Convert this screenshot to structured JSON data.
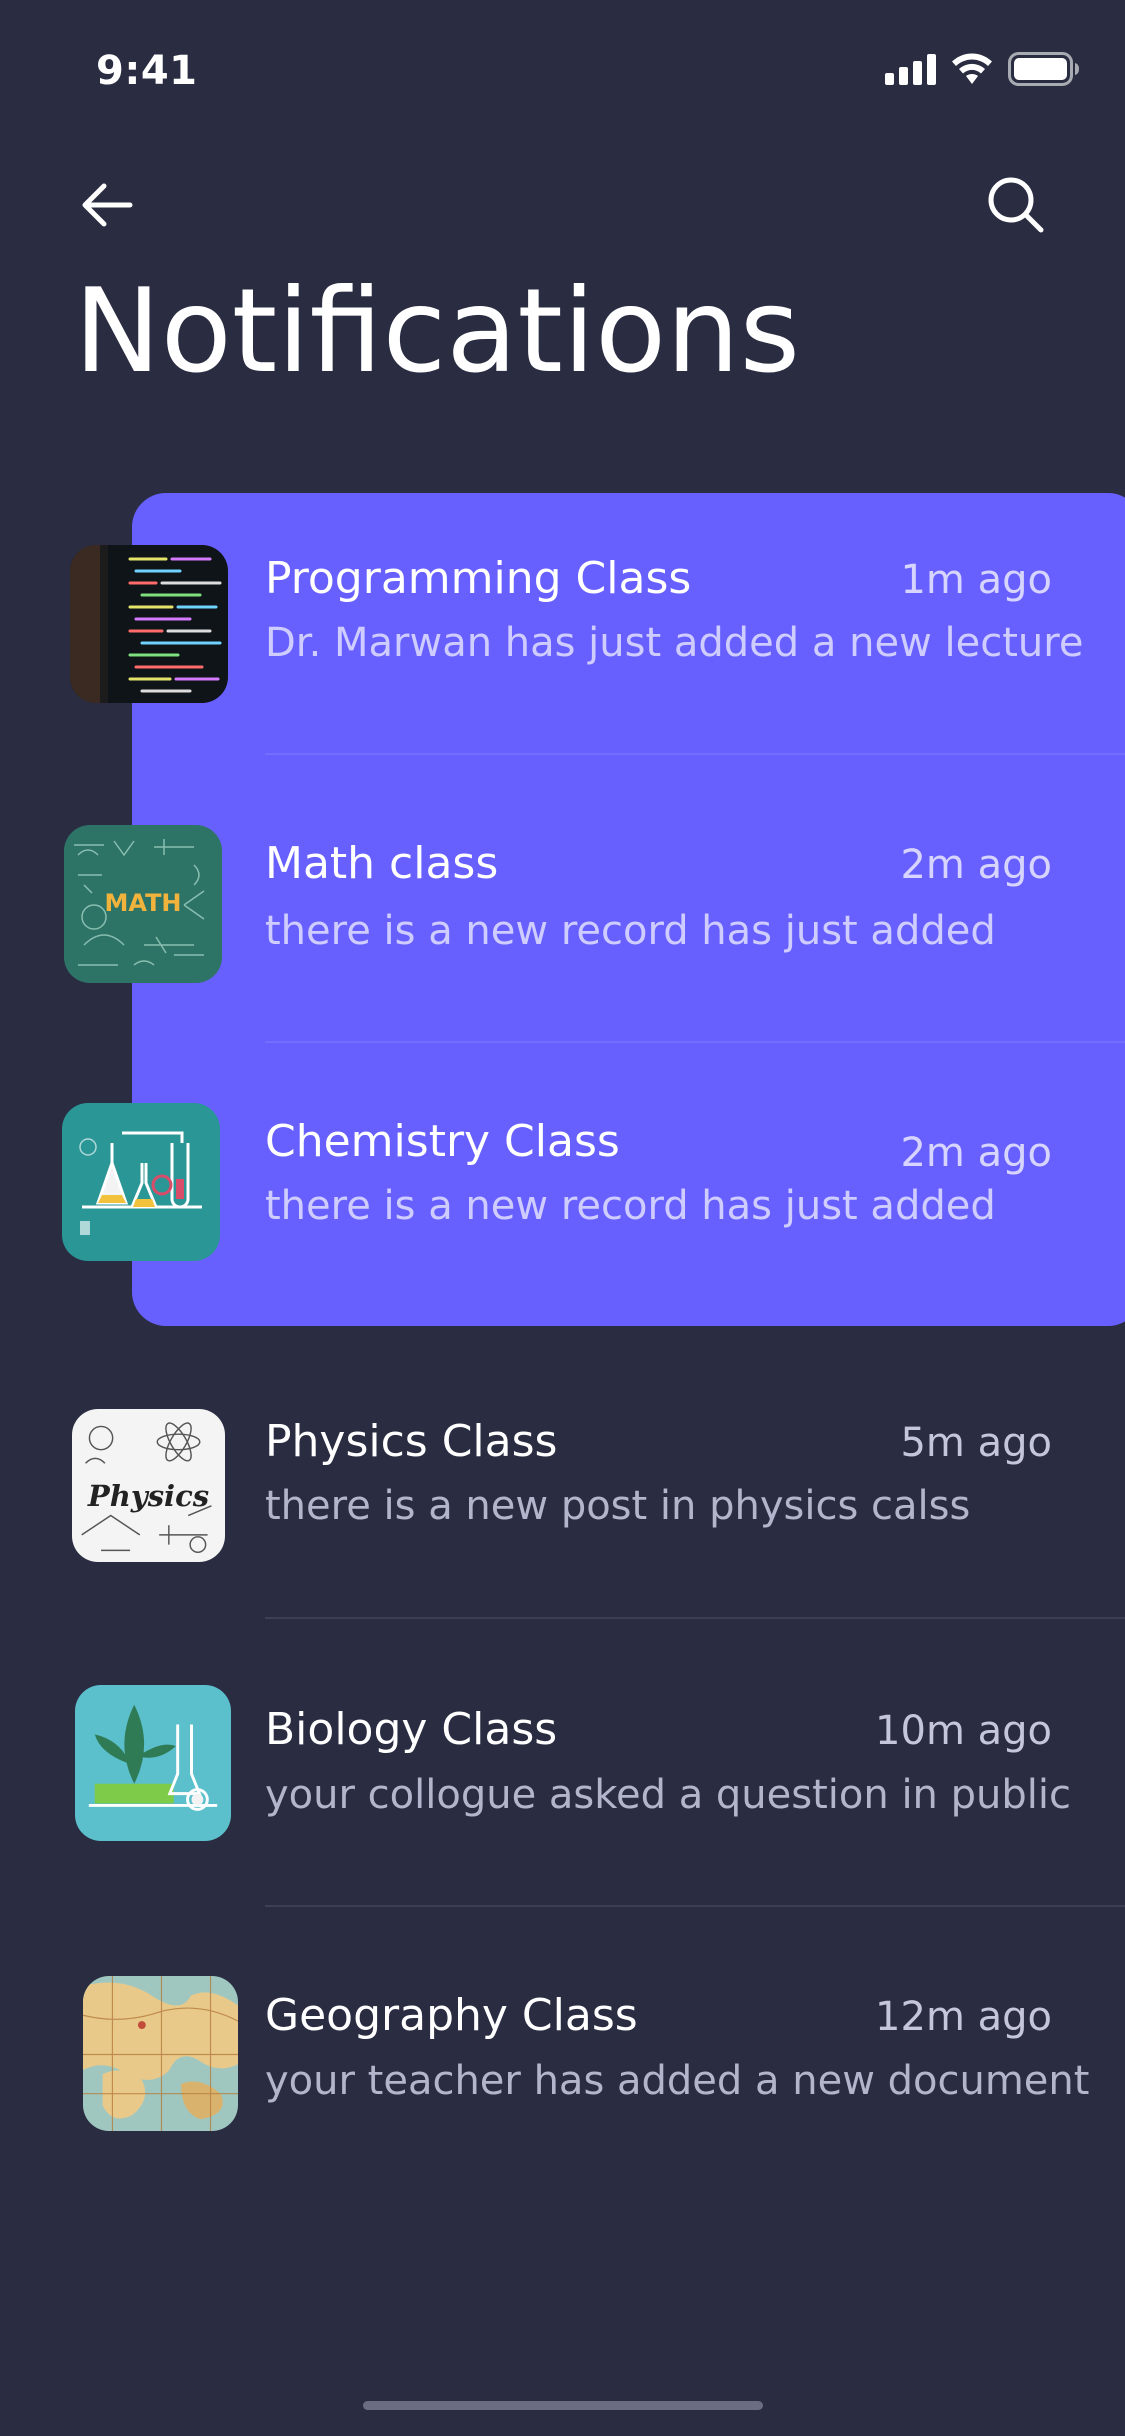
{
  "status_bar": {
    "time": "9:41"
  },
  "header": {
    "title": "Notifications",
    "back_icon": "arrow-left-icon",
    "search_icon": "search-icon"
  },
  "colors": {
    "background": "#2a2d42",
    "accent": "#6760ff"
  },
  "notifications": [
    {
      "title": "Programming Class",
      "time": "1m ago",
      "message": "Dr. Marwan has just added a new lecture",
      "highlighted": true
    },
    {
      "title": "Math class",
      "time": "2m ago",
      "message": "there is a new record has just added",
      "highlighted": true
    },
    {
      "title": "Chemistry Class",
      "time": "2m ago",
      "message": "there is a new record has just added",
      "highlighted": true
    },
    {
      "title": "Physics Class",
      "time": "5m ago",
      "message": "there is a new post in physics calss",
      "highlighted": false
    },
    {
      "title": "Biology Class",
      "time": "10m ago",
      "message": "your collogue asked a question in public",
      "highlighted": false
    },
    {
      "title": "Geography Class",
      "time": "12m ago",
      "message": "your teacher has added a new document",
      "highlighted": false
    }
  ],
  "thumbnails": {
    "math_label": "MATH",
    "physics_label": "Physics"
  }
}
